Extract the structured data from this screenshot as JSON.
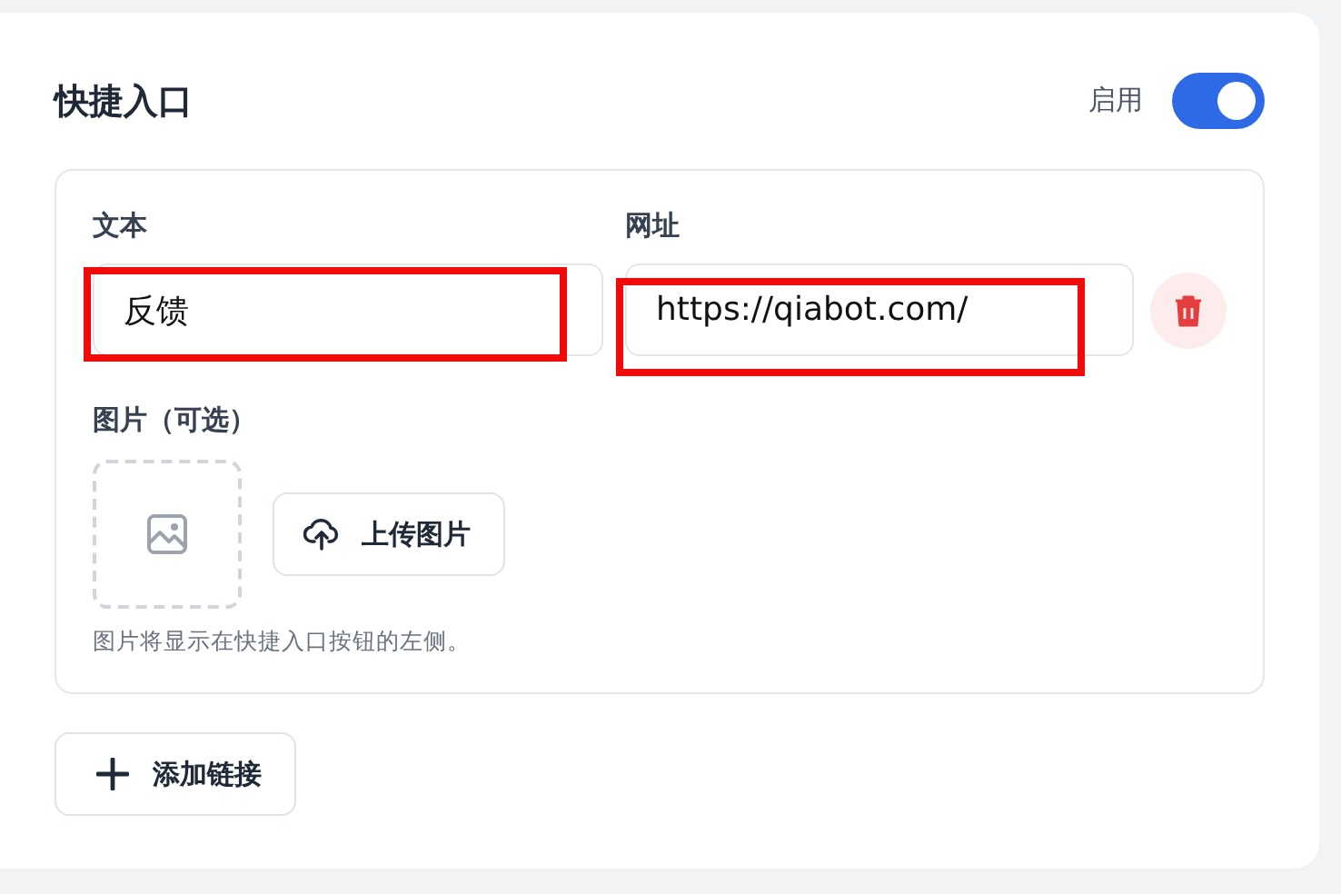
{
  "section": {
    "title": "快捷入口",
    "enabled_label": "启用",
    "enabled": true
  },
  "entries": [
    {
      "text_label": "文本",
      "text_value": "反馈",
      "text_highlighted": true,
      "url_label": "网址",
      "url_value": "https://qiabot.com/",
      "url_highlighted": true,
      "image_label": "图片（可选）",
      "upload_button": "上传图片",
      "image_hint": "图片将显示在快捷入口按钮的左侧。"
    }
  ],
  "add_button": {
    "label": "添加链接"
  }
}
